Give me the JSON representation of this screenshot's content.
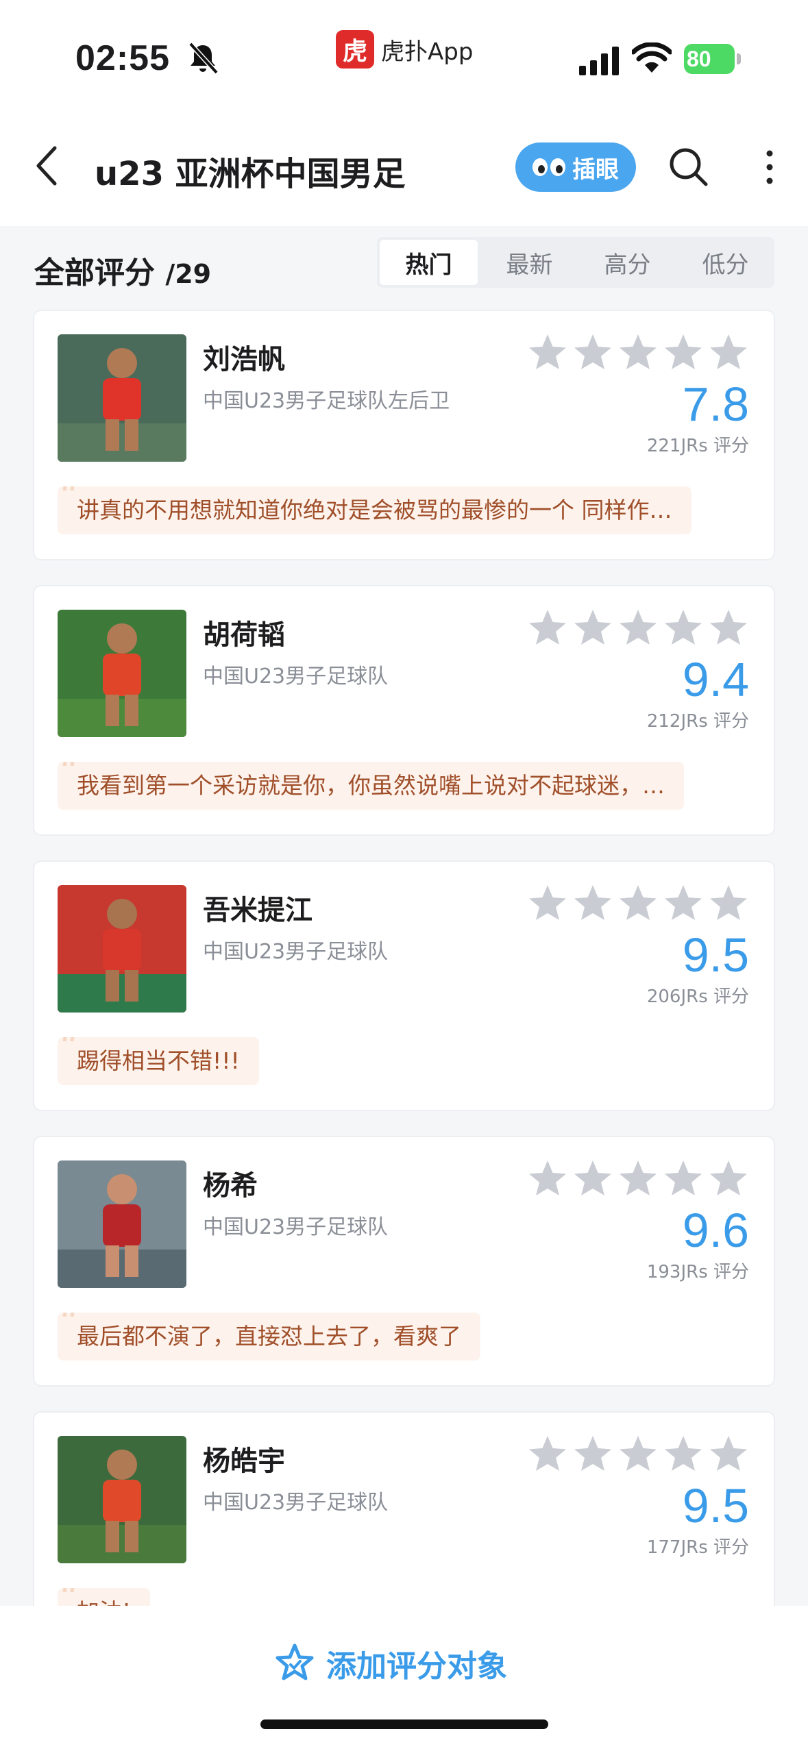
{
  "status_bar": {
    "time": "02:55",
    "app_name": "虎扑App",
    "app_logo_char": "虎",
    "battery": "80"
  },
  "nav": {
    "title": "u23 亚洲杯中国男足",
    "peek_label": "插眼"
  },
  "header": {
    "all_ratings_label": "全部评分",
    "count": "/29",
    "sort_tabs": [
      "热门",
      "最新",
      "高分",
      "低分"
    ],
    "active_tab": "热门"
  },
  "players": [
    {
      "name": "刘浩帆",
      "team": "中国U23男子足球队左后卫",
      "score": "7.8",
      "votes": "221JRs 评分",
      "comment": "讲真的不用想就知道你绝对是会被骂的最惨的一个 同样作…",
      "stars": 4
    },
    {
      "name": "胡荷韬",
      "team": "中国U23男子足球队",
      "score": "9.4",
      "votes": "212JRs 评分",
      "comment": "我看到第一个采访就是你，你虽然说嘴上说对不起球迷，…",
      "stars": 5
    },
    {
      "name": "吾米提江",
      "team": "中国U23男子足球队",
      "score": "9.5",
      "votes": "206JRs 评分",
      "comment": "踢得相当不错!!!",
      "stars": 5
    },
    {
      "name": "杨希",
      "team": "中国U23男子足球队",
      "score": "9.6",
      "votes": "193JRs 评分",
      "comment": "最后都不演了，直接怼上去了，看爽了",
      "stars": 5
    },
    {
      "name": "杨皓宇",
      "team": "中国U23男子足球队",
      "score": "9.5",
      "votes": "177JRs 评分",
      "comment": "加油!",
      "stars": 5
    }
  ],
  "bottom": {
    "add_label": "添加评分对象"
  },
  "colors": {
    "accent": "#3a9be9",
    "star_empty": "#c9ccd2",
    "comment_bg": "#fdf3ec",
    "comment_text": "#a04f2a"
  }
}
